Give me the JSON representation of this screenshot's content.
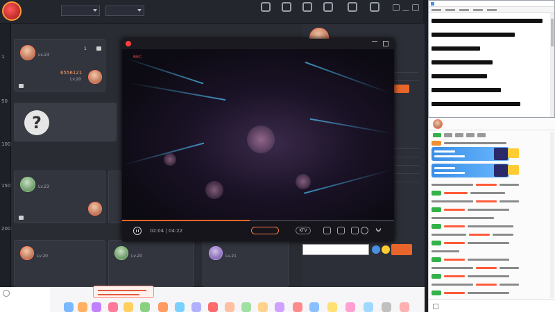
{
  "app": {
    "logo_text": "",
    "region_select": "",
    "room_type_select": "",
    "nav": [
      {
        "id": "teach",
        "label": ""
      },
      {
        "id": "rank",
        "label": ""
      },
      {
        "id": "bag",
        "label": ""
      },
      {
        "id": "mall",
        "label": ""
      },
      {
        "id": "event",
        "label": ""
      },
      {
        "id": "speed",
        "label": ""
      }
    ]
  },
  "ruler": [
    "1",
    "50",
    "100",
    "150",
    "200"
  ],
  "rooms": {
    "row_headers": [
      "",
      "",
      ""
    ],
    "create_header": "",
    "create_label": "",
    "table4_header": "",
    "table7_header": "",
    "card1": {
      "name": "",
      "level": "Lv.23",
      "score": "6556121",
      "level2": "Lv.20",
      "count": "1",
      "status": ""
    },
    "card4": {
      "name": "",
      "level": "Lv.23",
      "tag": "",
      "level2": "",
      "status": ""
    },
    "card7a": {
      "name": "",
      "level": "Lv.20"
    },
    "card7b": {
      "name": "",
      "level": "Lv.20"
    },
    "card7c": {
      "name": "",
      "level": "Lv.21"
    }
  },
  "side": {
    "top_name": "",
    "mode_button": ""
  },
  "player": {
    "title": "",
    "rec": "REC",
    "time_current": "02:04",
    "time_total": "04:22",
    "progress": 0.47,
    "mode_label": "",
    "ktv_label": "KTV"
  },
  "chat": {
    "input_placeholder": "",
    "send_label": ""
  },
  "notepad": {
    "title": "",
    "lines": 10
  },
  "chatpanel": {
    "messages": 22
  }
}
